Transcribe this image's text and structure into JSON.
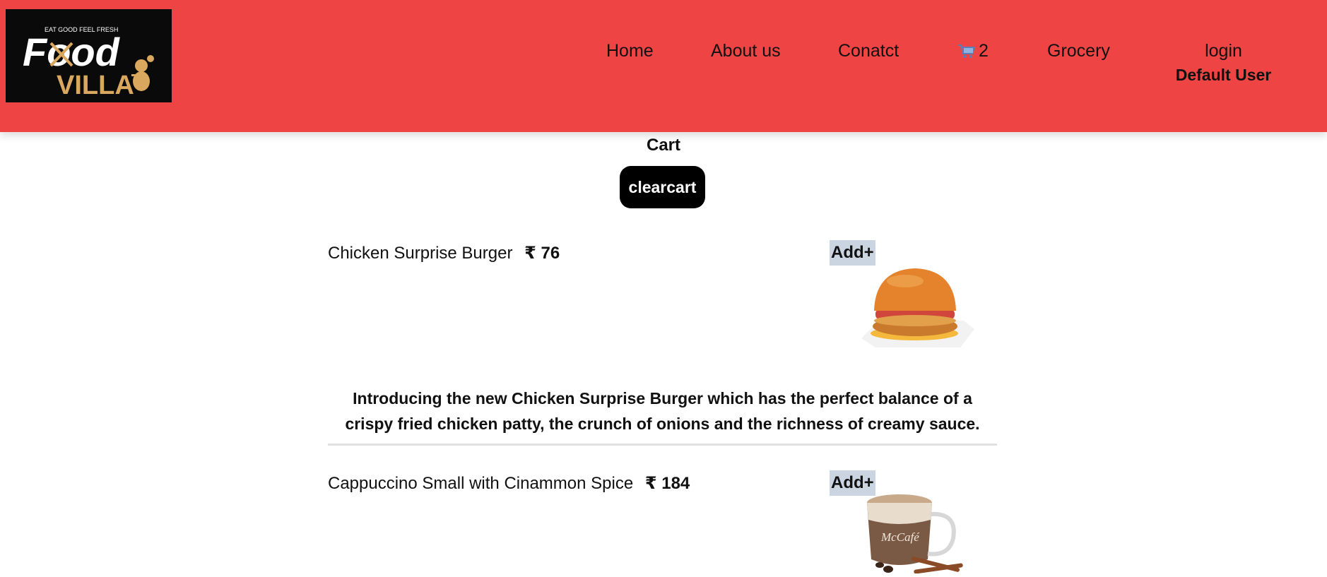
{
  "header": {
    "logo": {
      "tagline": "EAT GOOD FEEL FRESH",
      "brand_top": "Food",
      "brand_bottom": "VILLA"
    },
    "nav": {
      "home": "Home",
      "about": "About us",
      "contact": "Conatct",
      "cart_icon": "shopping-cart-icon",
      "cart_count": "2",
      "grocery": "Grocery",
      "login": "login",
      "user": "Default User"
    },
    "colors": {
      "background": "#ef4444",
      "logo_bg": "#0a0a0a",
      "logo_gold": "#d9a75e"
    }
  },
  "cart": {
    "title": "Cart",
    "clear_label": "clearcart",
    "currency": "₹",
    "items": [
      {
        "name": "Chicken Surprise Burger",
        "price": "76",
        "add_label": "Add+",
        "image": "burger-image",
        "description": "Introducing the new Chicken Surprise Burger which has the perfect balance of a crispy fried chicken patty, the crunch of onions and the richness of creamy sauce."
      },
      {
        "name": "Cappuccino Small with Cinammon Spice",
        "price": "184",
        "add_label": "Add+",
        "image": "cappuccino-image",
        "image_text": "McCafé"
      }
    ]
  }
}
